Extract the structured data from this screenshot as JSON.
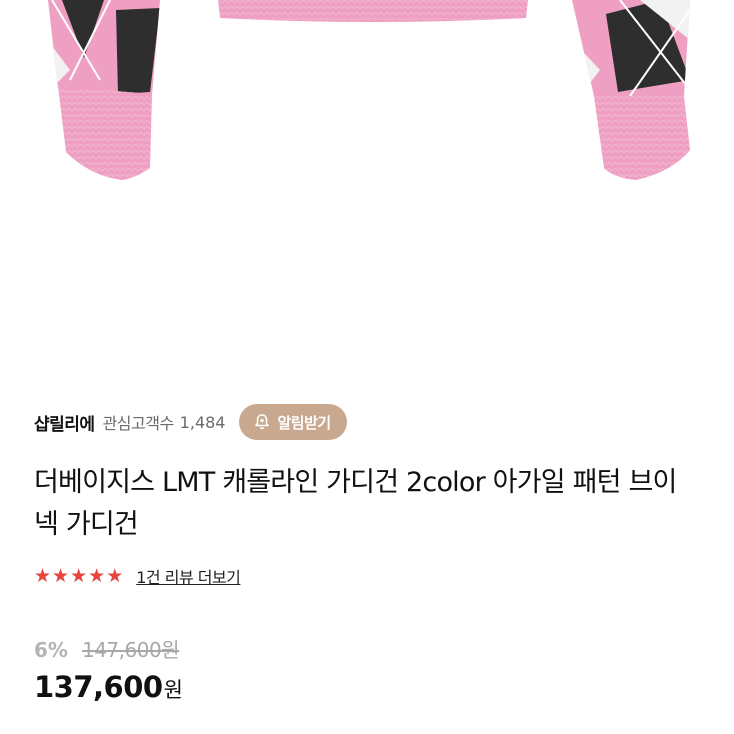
{
  "product_image": {
    "alt": "pink argyle knit cardigan sleeves"
  },
  "shop": {
    "name": "샵릴리에",
    "follower_label": "관심고객수",
    "follower_count": "1,484",
    "notify_label": "알림받기",
    "notify_icon": "bell-plus-icon"
  },
  "product": {
    "title": "더베이지스 LMT 캐롤라인 가디건 2color 아가일 패턴 브이넥 가디건"
  },
  "rating": {
    "stars": 5,
    "review_link": "1건 리뷰 더보기",
    "star_color": "#e8453c"
  },
  "price": {
    "discount": "6%",
    "original": "147,600원",
    "current": "137,600",
    "currency": "원"
  },
  "colors": {
    "notify_button_bg": "#c8a98f",
    "sweater_pink": "#ee9fc2",
    "argyle_dark": "#2e2e2e"
  }
}
